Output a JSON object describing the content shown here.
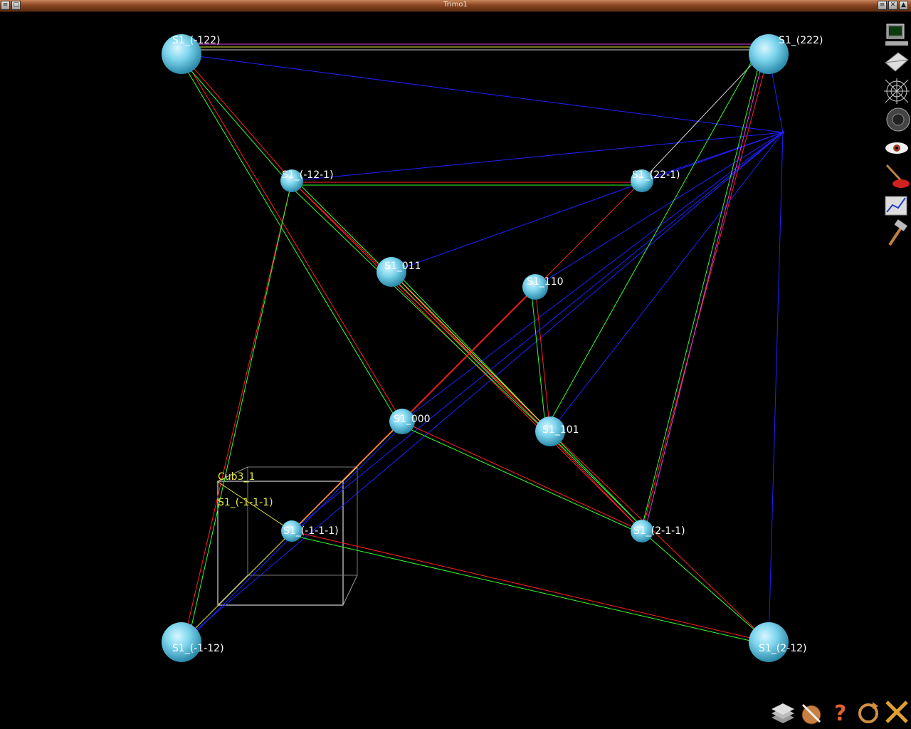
{
  "window": {
    "title": "Trimo1",
    "buttons": [
      "minimize",
      "close",
      "maximize"
    ]
  },
  "scene": {
    "nodes": [
      {
        "id": "n_-122",
        "label": "S1_(-122)"
      },
      {
        "id": "n_222",
        "label": "S1_(222)"
      },
      {
        "id": "n_-12-1",
        "label": "S1_(-12-1)"
      },
      {
        "id": "n_22-1",
        "label": "S1_(22-1)"
      },
      {
        "id": "n_011",
        "label": "S1_011"
      },
      {
        "id": "n_110",
        "label": "S1_110"
      },
      {
        "id": "n_000",
        "label": "S1_000"
      },
      {
        "id": "n_101",
        "label": "S1_101"
      },
      {
        "id": "n_2-1-1",
        "label": "S1_(2-1-1)"
      },
      {
        "id": "n_-1-1-1",
        "label": "S1_(-1-1-1)"
      },
      {
        "id": "n_-1-12",
        "label": "S1_(-1-12)"
      },
      {
        "id": "n_2-12",
        "label": "S1_(2-12)"
      }
    ],
    "cube_label": "Cub3_1",
    "selected_label": "S1_(-1-1-1)",
    "colors": {
      "node": "#7fd6ee",
      "edge_red": "#ff2020",
      "edge_green": "#30ff30",
      "edge_blue": "#2020ff",
      "edge_magenta": "#e040e0",
      "edge_white": "#d0d0d0",
      "edge_yellow": "#e8e840",
      "label_white": "#ffffff",
      "label_yellow": "#e8e840"
    }
  },
  "side_dock": {
    "icons": [
      "monitor-icon",
      "mail-icon",
      "spider-web-icon",
      "speaker-icon",
      "eye-icon",
      "paint-icon",
      "chart-icon",
      "hammer-icon"
    ]
  },
  "bottom_dock": {
    "icons": [
      "stack-icon",
      "pen-icon",
      "help-icon",
      "refresh-icon",
      "exit-icon"
    ]
  }
}
